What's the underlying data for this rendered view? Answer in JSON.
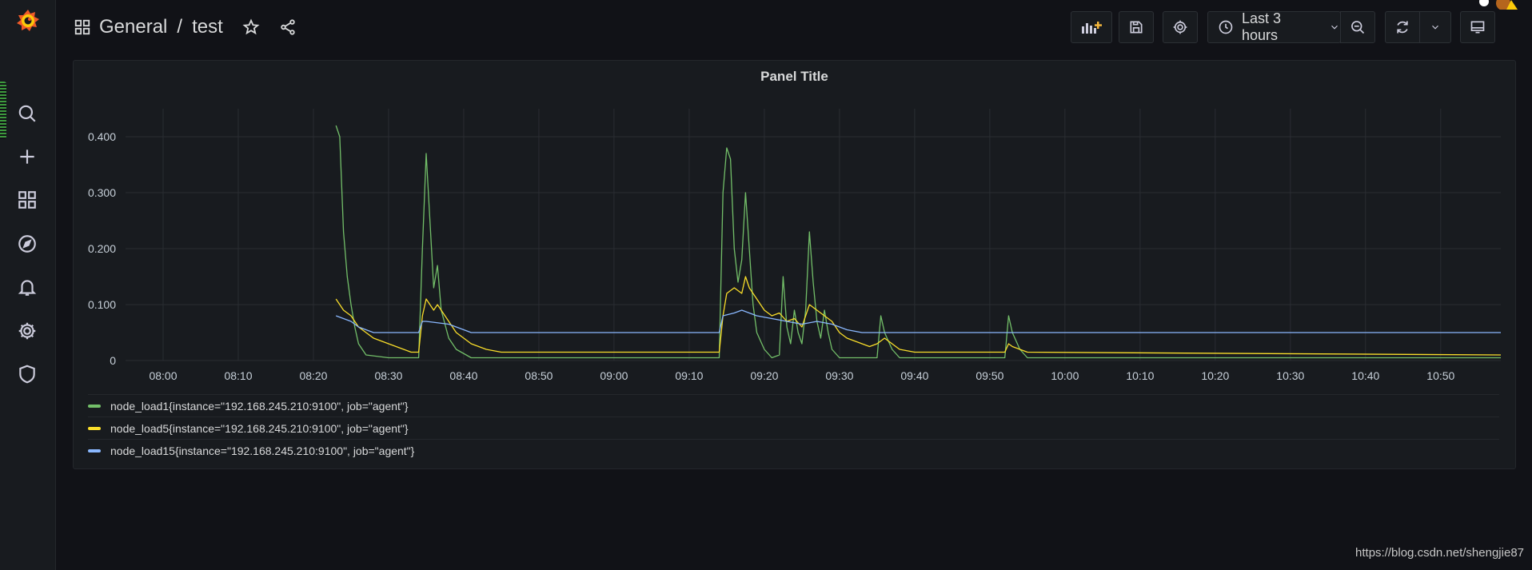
{
  "app": {
    "breadcrumb": {
      "folder": "General",
      "separator": "/",
      "dashboard": "test"
    },
    "sidebar": {
      "items": [
        {
          "name": "search-icon"
        },
        {
          "name": "plus-icon"
        },
        {
          "name": "dashboards-icon"
        },
        {
          "name": "explore-compass-icon"
        },
        {
          "name": "alerting-bell-icon"
        },
        {
          "name": "configuration-gear-icon"
        },
        {
          "name": "server-admin-shield-icon"
        }
      ]
    },
    "toolbar": {
      "time_range": "Last 3 hours"
    }
  },
  "panel": {
    "title": "Panel Title"
  },
  "colors": {
    "load1": "#73bf69",
    "load5": "#fade2a",
    "load15": "#8ab8ff",
    "accent": "#f05a28"
  },
  "legend": [
    {
      "label": "node_load1{instance=\"192.168.245.210:9100\", job=\"agent\"}",
      "color": "#73bf69"
    },
    {
      "label": "node_load5{instance=\"192.168.245.210:9100\", job=\"agent\"}",
      "color": "#fade2a"
    },
    {
      "label": "node_load15{instance=\"192.168.245.210:9100\", job=\"agent\"}",
      "color": "#8ab8ff"
    }
  ],
  "chart_data": {
    "type": "line",
    "title": "Panel Title",
    "xlabel": "",
    "ylabel": "",
    "xlim": [
      "07:55",
      "10:58"
    ],
    "ylim": [
      0,
      0.45
    ],
    "grid": true,
    "legend_position": "bottom",
    "x_ticks": [
      "08:00",
      "08:10",
      "08:20",
      "08:30",
      "08:40",
      "08:50",
      "09:00",
      "09:10",
      "09:20",
      "09:30",
      "09:40",
      "09:50",
      "10:00",
      "10:10",
      "10:20",
      "10:30",
      "10:40",
      "10:50"
    ],
    "y_ticks": [
      {
        "value": 0,
        "label": "0"
      },
      {
        "value": 0.1,
        "label": "0.100"
      },
      {
        "value": 0.2,
        "label": "0.200"
      },
      {
        "value": 0.3,
        "label": "0.300"
      },
      {
        "value": 0.4,
        "label": "0.400"
      }
    ],
    "series": [
      {
        "name": "node_load1{instance=\"192.168.245.210:9100\", job=\"agent\"}",
        "color": "#73bf69",
        "points": [
          [
            "08:23",
            0.42
          ],
          [
            "08:23:30",
            0.4
          ],
          [
            "08:24",
            0.23
          ],
          [
            "08:24:30",
            0.15
          ],
          [
            "08:25",
            0.1
          ],
          [
            "08:25:30",
            0.06
          ],
          [
            "08:26",
            0.03
          ],
          [
            "08:27",
            0.01
          ],
          [
            "08:30",
            0.005
          ],
          [
            "08:34",
            0.005
          ],
          [
            "08:34:30",
            0.2
          ],
          [
            "08:35",
            0.37
          ],
          [
            "08:35:30",
            0.25
          ],
          [
            "08:36",
            0.13
          ],
          [
            "08:36:30",
            0.17
          ],
          [
            "08:37",
            0.09
          ],
          [
            "08:38",
            0.04
          ],
          [
            "08:39",
            0.02
          ],
          [
            "08:41",
            0.005
          ],
          [
            "09:14",
            0.005
          ],
          [
            "09:14:30",
            0.3
          ],
          [
            "09:15",
            0.38
          ],
          [
            "09:15:30",
            0.36
          ],
          [
            "09:16",
            0.2
          ],
          [
            "09:16:30",
            0.14
          ],
          [
            "09:17",
            0.18
          ],
          [
            "09:17:30",
            0.3
          ],
          [
            "09:18",
            0.2
          ],
          [
            "09:18:30",
            0.1
          ],
          [
            "09:19",
            0.05
          ],
          [
            "09:20",
            0.02
          ],
          [
            "09:21",
            0.005
          ],
          [
            "09:22",
            0.01
          ],
          [
            "09:22:30",
            0.15
          ],
          [
            "09:23",
            0.06
          ],
          [
            "09:23:30",
            0.03
          ],
          [
            "09:24",
            0.09
          ],
          [
            "09:24:30",
            0.05
          ],
          [
            "09:25",
            0.03
          ],
          [
            "09:25:30",
            0.09
          ],
          [
            "09:26",
            0.23
          ],
          [
            "09:26:30",
            0.14
          ],
          [
            "09:27",
            0.07
          ],
          [
            "09:27:30",
            0.04
          ],
          [
            "09:28",
            0.09
          ],
          [
            "09:28:30",
            0.05
          ],
          [
            "09:29",
            0.02
          ],
          [
            "09:30",
            0.005
          ],
          [
            "09:35",
            0.005
          ],
          [
            "09:35:30",
            0.08
          ],
          [
            "09:36",
            0.05
          ],
          [
            "09:37",
            0.02
          ],
          [
            "09:38",
            0.005
          ],
          [
            "09:52",
            0.005
          ],
          [
            "09:52:30",
            0.08
          ],
          [
            "09:53",
            0.05
          ],
          [
            "09:54",
            0.02
          ],
          [
            "09:55",
            0.005
          ],
          [
            "10:58",
            0.005
          ]
        ]
      },
      {
        "name": "node_load5{instance=\"192.168.245.210:9100\", job=\"agent\"}",
        "color": "#fade2a",
        "points": [
          [
            "08:23",
            0.11
          ],
          [
            "08:23:30",
            0.1
          ],
          [
            "08:24",
            0.09
          ],
          [
            "08:25",
            0.08
          ],
          [
            "08:26",
            0.06
          ],
          [
            "08:27",
            0.05
          ],
          [
            "08:28",
            0.04
          ],
          [
            "08:29",
            0.035
          ],
          [
            "08:30",
            0.03
          ],
          [
            "08:31",
            0.025
          ],
          [
            "08:32",
            0.02
          ],
          [
            "08:33",
            0.015
          ],
          [
            "08:34",
            0.015
          ],
          [
            "08:34:30",
            0.08
          ],
          [
            "08:35",
            0.11
          ],
          [
            "08:35:30",
            0.1
          ],
          [
            "08:36",
            0.09
          ],
          [
            "08:36:30",
            0.1
          ],
          [
            "08:37",
            0.09
          ],
          [
            "08:38",
            0.07
          ],
          [
            "08:39",
            0.05
          ],
          [
            "08:40",
            0.04
          ],
          [
            "08:41",
            0.03
          ],
          [
            "08:42",
            0.025
          ],
          [
            "08:43",
            0.02
          ],
          [
            "08:45",
            0.015
          ],
          [
            "09:14",
            0.015
          ],
          [
            "09:14:30",
            0.08
          ],
          [
            "09:15",
            0.12
          ],
          [
            "09:16",
            0.13
          ],
          [
            "09:17",
            0.12
          ],
          [
            "09:17:30",
            0.15
          ],
          [
            "09:18",
            0.13
          ],
          [
            "09:19",
            0.11
          ],
          [
            "09:20",
            0.09
          ],
          [
            "09:21",
            0.08
          ],
          [
            "09:22",
            0.085
          ],
          [
            "09:23",
            0.07
          ],
          [
            "09:24",
            0.075
          ],
          [
            "09:25",
            0.06
          ],
          [
            "09:26",
            0.1
          ],
          [
            "09:27",
            0.09
          ],
          [
            "09:28",
            0.08
          ],
          [
            "09:29",
            0.07
          ],
          [
            "09:30",
            0.05
          ],
          [
            "09:31",
            0.04
          ],
          [
            "09:32",
            0.035
          ],
          [
            "09:33",
            0.03
          ],
          [
            "09:34",
            0.025
          ],
          [
            "09:35",
            0.03
          ],
          [
            "09:36",
            0.04
          ],
          [
            "09:37",
            0.03
          ],
          [
            "09:38",
            0.02
          ],
          [
            "09:40",
            0.015
          ],
          [
            "09:52",
            0.015
          ],
          [
            "09:52:30",
            0.03
          ],
          [
            "09:53",
            0.025
          ],
          [
            "09:54",
            0.02
          ],
          [
            "09:55",
            0.015
          ],
          [
            "10:58",
            0.01
          ]
        ]
      },
      {
        "name": "node_load15{instance=\"192.168.245.210:9100\", job=\"agent\"}",
        "color": "#8ab8ff",
        "points": [
          [
            "08:23",
            0.08
          ],
          [
            "08:24",
            0.075
          ],
          [
            "08:25",
            0.07
          ],
          [
            "08:26",
            0.06
          ],
          [
            "08:27",
            0.055
          ],
          [
            "08:28",
            0.05
          ],
          [
            "08:34",
            0.05
          ],
          [
            "08:34:30",
            0.07
          ],
          [
            "08:35",
            0.07
          ],
          [
            "08:38",
            0.065
          ],
          [
            "08:39",
            0.06
          ],
          [
            "08:40",
            0.055
          ],
          [
            "08:41",
            0.05
          ],
          [
            "09:14",
            0.05
          ],
          [
            "09:14:30",
            0.08
          ],
          [
            "09:16",
            0.085
          ],
          [
            "09:17",
            0.09
          ],
          [
            "09:18",
            0.085
          ],
          [
            "09:19",
            0.08
          ],
          [
            "09:21",
            0.075
          ],
          [
            "09:23",
            0.07
          ],
          [
            "09:25",
            0.065
          ],
          [
            "09:27",
            0.07
          ],
          [
            "09:29",
            0.065
          ],
          [
            "09:30",
            0.06
          ],
          [
            "09:31",
            0.055
          ],
          [
            "09:33",
            0.05
          ],
          [
            "10:58",
            0.05
          ]
        ]
      }
    ]
  },
  "footer": {
    "watermark": "https://blog.csdn.net/shengjie87"
  }
}
